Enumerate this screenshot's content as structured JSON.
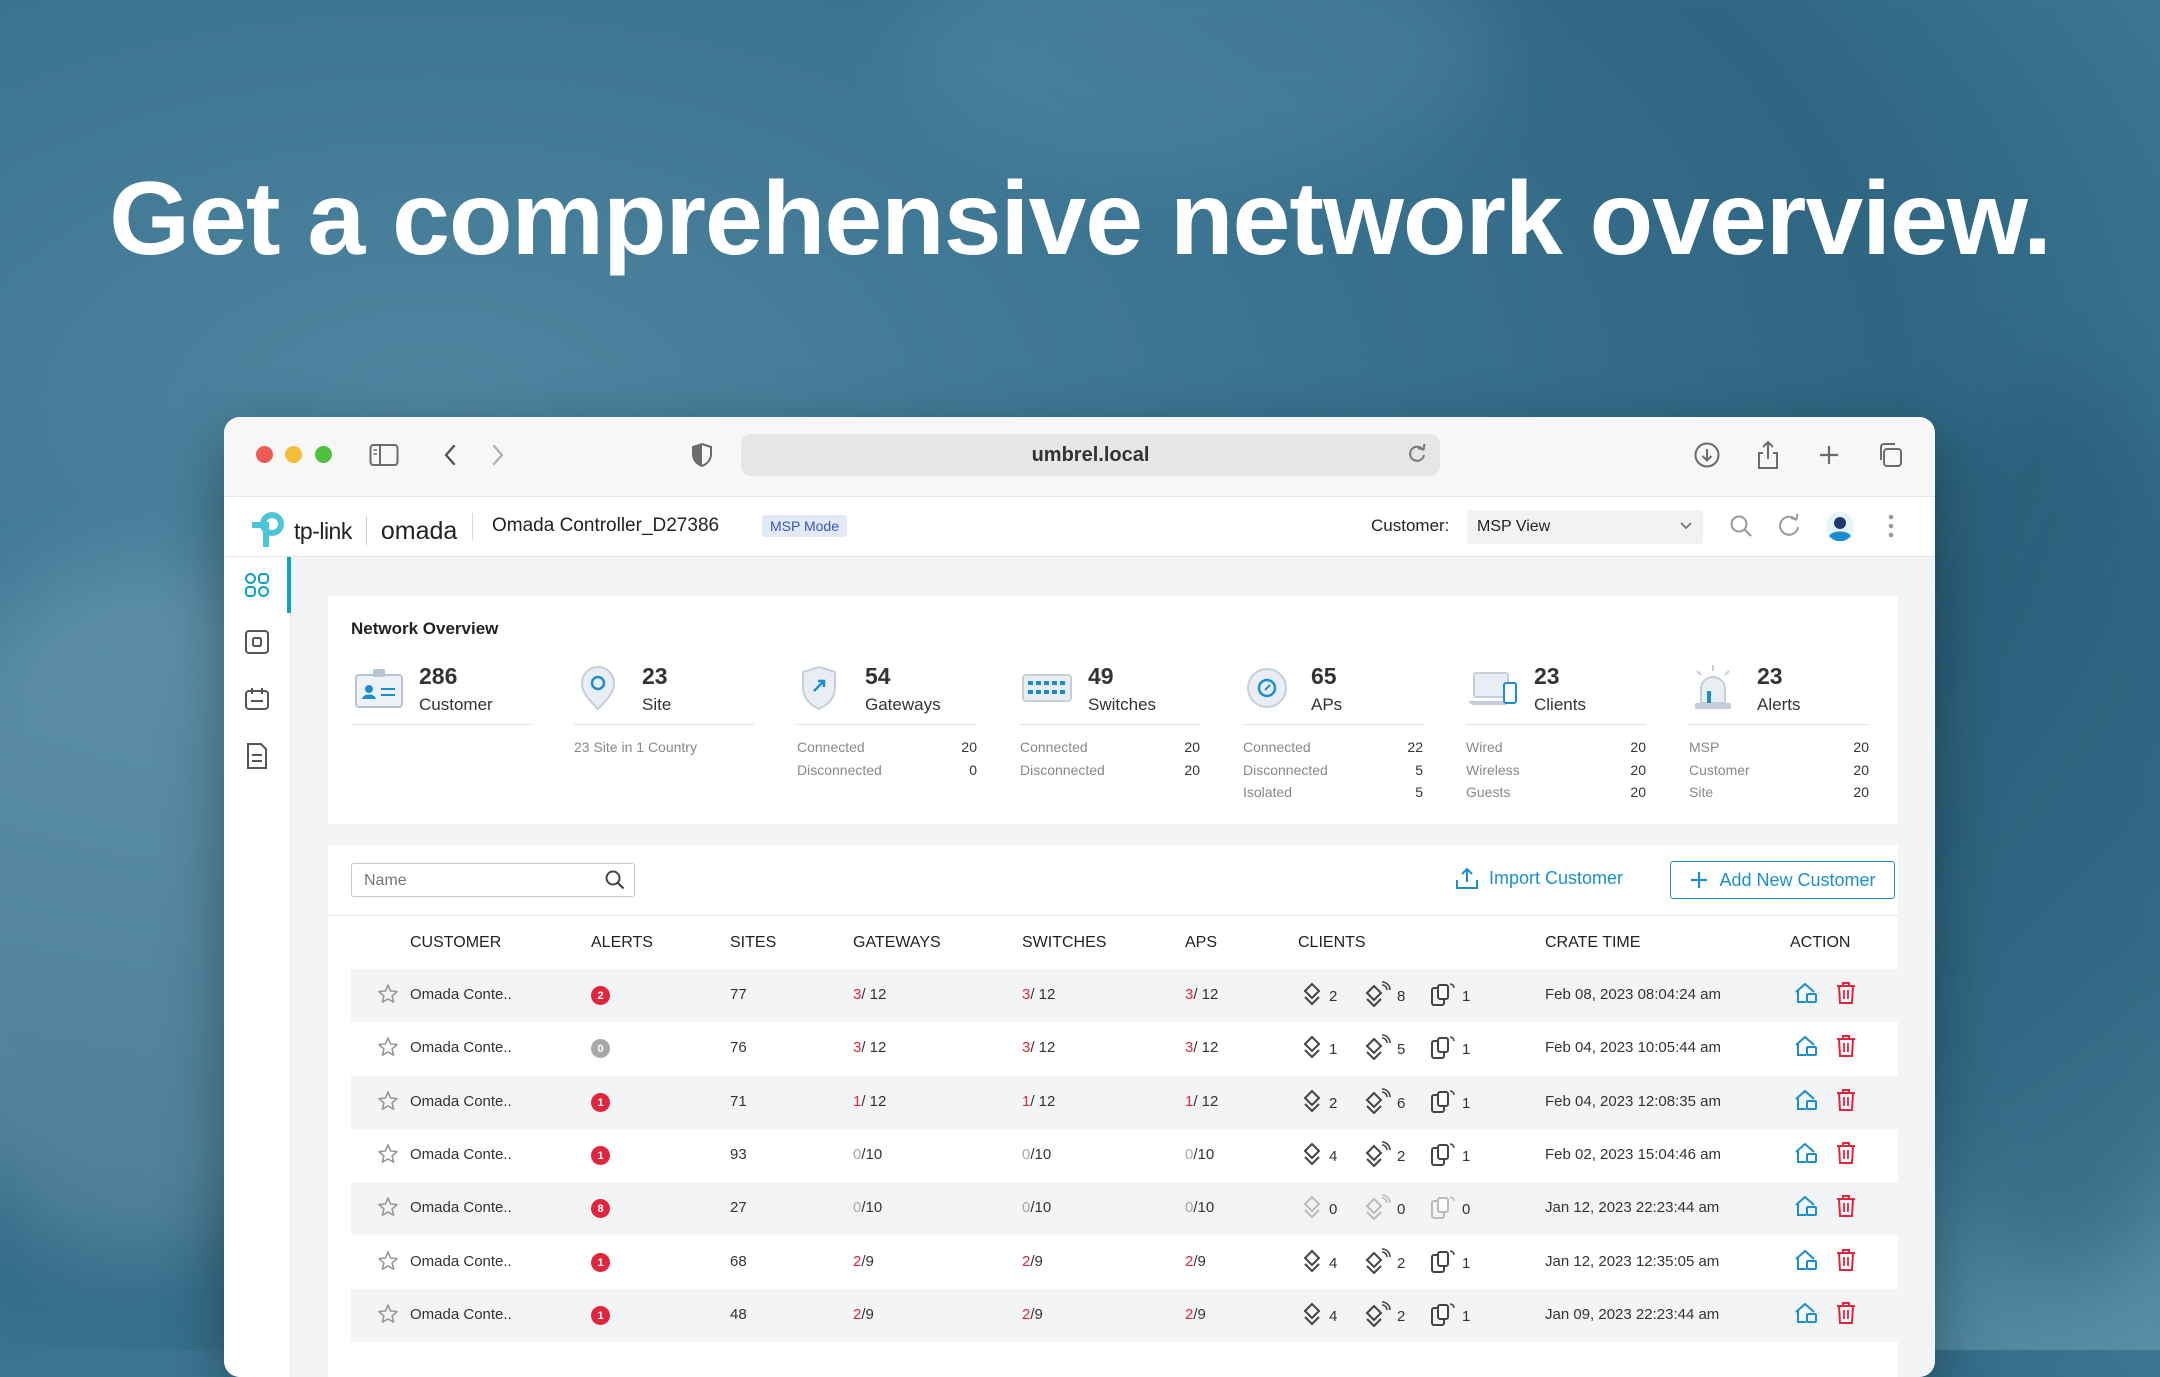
{
  "headline": "Get a comprehensive network overview.",
  "browser": {
    "url": "umbrel.local"
  },
  "app": {
    "brand": "tp-link",
    "product": "omada",
    "controller_name": "Omada Controller_D27386",
    "mode_badge": "MSP Mode",
    "customer_label": "Customer:",
    "customer_select": "MSP View"
  },
  "overview": {
    "title": "Network Overview",
    "stats": [
      {
        "num": "286",
        "label": "Customer",
        "rows": []
      },
      {
        "num": "23",
        "label": "Site",
        "note": "23 Site in 1 Country",
        "rows": []
      },
      {
        "num": "54",
        "label": "Gateways",
        "rows": [
          {
            "k": "Connected",
            "v": "20"
          },
          {
            "k": "Disconnected",
            "v": "0"
          }
        ]
      },
      {
        "num": "49",
        "label": "Switches",
        "rows": [
          {
            "k": "Connected",
            "v": "20"
          },
          {
            "k": "Disconnected",
            "v": "20"
          }
        ]
      },
      {
        "num": "65",
        "label": "APs",
        "rows": [
          {
            "k": "Connected",
            "v": "22"
          },
          {
            "k": "Disconnected",
            "v": "5"
          },
          {
            "k": "Isolated",
            "v": "5"
          }
        ]
      },
      {
        "num": "23",
        "label": "Clients",
        "rows": [
          {
            "k": "Wired",
            "v": "20"
          },
          {
            "k": "Wireless",
            "v": "20"
          },
          {
            "k": "Guests",
            "v": "20"
          }
        ]
      },
      {
        "num": "23",
        "label": "Alerts",
        "rows": [
          {
            "k": "MSP",
            "v": "20"
          },
          {
            "k": "Customer",
            "v": "20"
          },
          {
            "k": "Site",
            "v": "20"
          }
        ]
      }
    ]
  },
  "list": {
    "search_placeholder": "Name",
    "import_label": "Import Customer",
    "add_label": "Add New Customer",
    "headers": {
      "customer": "CUSTOMER",
      "alerts": "ALERTS",
      "sites": "SITES",
      "gateways": "GATEWAYS",
      "switches": "SWITCHES",
      "aps": "APS",
      "clients": "CLIENTS",
      "time": "CRATE TIME",
      "action": "ACTION"
    },
    "rows": [
      {
        "name": "Omada Conte..",
        "alert": "2",
        "sites": "77",
        "gw_a": "3",
        "gw_b": "/ 12",
        "sw_a": "3",
        "sw_b": "/ 12",
        "ap_a": "3",
        "ap_b": "/ 12",
        "wired": "2",
        "wireless": "8",
        "guest": "1",
        "time": "Feb 08, 2023 08:04:24 am"
      },
      {
        "name": "Omada Conte..",
        "alert": "0",
        "sites": "76",
        "gw_a": "3",
        "gw_b": "/ 12",
        "sw_a": "3",
        "sw_b": "/ 12",
        "ap_a": "3",
        "ap_b": "/ 12",
        "wired": "1",
        "wireless": "5",
        "guest": "1",
        "time": "Feb 04, 2023 10:05:44 am"
      },
      {
        "name": "Omada Conte..",
        "alert": "1",
        "sites": "71",
        "gw_a": "1",
        "gw_b": "/ 12",
        "sw_a": "1",
        "sw_b": "/ 12",
        "ap_a": "1",
        "ap_b": "/ 12",
        "wired": "2",
        "wireless": "6",
        "guest": "1",
        "time": "Feb 04, 2023 12:08:35 am"
      },
      {
        "name": "Omada Conte..",
        "alert": "1",
        "sites": "93",
        "gw_a": "0",
        "gw_b": "/10",
        "sw_a": "0",
        "sw_b": "/10",
        "ap_a": "0",
        "ap_b": "/10",
        "wired": "4",
        "wireless": "2",
        "guest": "1",
        "time": "Feb 02, 2023 15:04:46 am"
      },
      {
        "name": "Omada Conte..",
        "alert": "8",
        "sites": "27",
        "gw_a": "0",
        "gw_b": "/10",
        "sw_a": "0",
        "sw_b": "/10",
        "ap_a": "0",
        "ap_b": "/10",
        "wired": "0",
        "wireless": "0",
        "guest": "0",
        "time": "Jan 12, 2023 22:23:44 am"
      },
      {
        "name": "Omada Conte..",
        "alert": "1",
        "sites": "68",
        "gw_a": "2",
        "gw_b": "/9",
        "sw_a": "2",
        "sw_b": "/9",
        "ap_a": "2",
        "ap_b": "/9",
        "wired": "4",
        "wireless": "2",
        "guest": "1",
        "time": "Jan 12, 2023 12:35:05 am"
      },
      {
        "name": "Omada Conte..",
        "alert": "1",
        "sites": "48",
        "gw_a": "2",
        "gw_b": "/9",
        "sw_a": "2",
        "sw_b": "/9",
        "ap_a": "2",
        "ap_b": "/9",
        "wired": "4",
        "wireless": "2",
        "guest": "1",
        "time": "Jan 09, 2023 22:23:44 am"
      }
    ]
  },
  "colors": {
    "accent": "#1b8fce",
    "teal": "#0aa3c2",
    "danger": "#e0253f",
    "alert_zero": "#a8a8a8"
  }
}
